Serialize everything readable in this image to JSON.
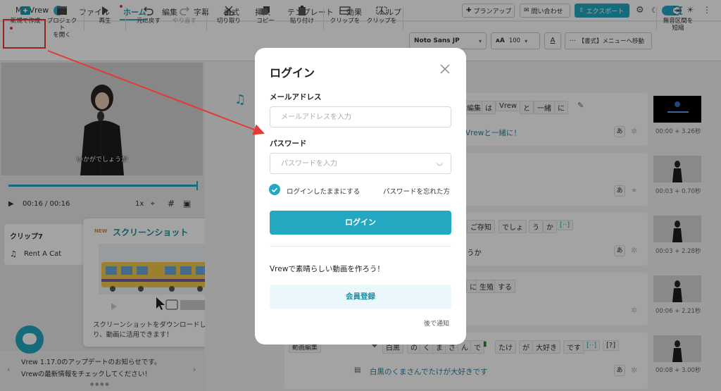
{
  "menubar": {
    "app_title": "My Vrew",
    "items": [
      "ファイル",
      "ホーム",
      "編集",
      "字幕",
      "書式",
      "挿入",
      "テンプレート",
      "効果",
      "ヘルプ"
    ],
    "plan_up": "プランアップ",
    "contact": "問い合わせ",
    "export": "エクスポート"
  },
  "toolbar": {
    "new_project": "新規で作成",
    "open_project_1": "プロジェクト",
    "open_project_2": "を開く",
    "play": "再生",
    "undo": "元に戻す",
    "redo": "やり直す",
    "cut": "切り取り",
    "copy": "コピー",
    "paste": "貼り付け",
    "clip1": "クリップを",
    "clip2": "クリップを",
    "font": "Noto Sans JP",
    "size": "100",
    "color_letter": "A",
    "format_menu": "【書式】メニューへ移動",
    "silence_1": "無音区間を",
    "silence_2": "短縮"
  },
  "player": {
    "subtitle": "いかがでしょうか",
    "current_time": "00:16",
    "total_time": "/ 00:16",
    "speed": "1x",
    "progress": 1.0
  },
  "clip_panel": {
    "clip_name": "クリップ7",
    "music_name": "Rent A Cat"
  },
  "screenshot_popup": {
    "badge": "NEW",
    "title": "スクリーンショット",
    "description": "スクリーンショットをダウンロードしたり、動画に活用できます！"
  },
  "update_bar": {
    "title": "Vrew 1.17.0のアップデートのお知らせです。",
    "subtitle": "Vrewの最新情報をチェックしてください！"
  },
  "rows": [
    {
      "words": [
        "編集",
        "は",
        "Vrew",
        "と",
        "一緒",
        "に"
      ],
      "caption": "Vrewと一緒に！",
      "time": "00:00 + 3.26秒"
    },
    {
      "words": [],
      "caption": "",
      "time": "00:03 + 0.70秒"
    },
    {
      "words": [
        "ご存知",
        "でしょ",
        "う",
        "か",
        "[··]"
      ],
      "caption": "うか",
      "time": "00:03 + 2.28秒"
    },
    {
      "words": [
        "に",
        "生殖",
        "する"
      ],
      "caption": "",
      "time": "00:06 + 2.21秒"
    },
    {
      "words": [
        "動画編集",
        "白黒",
        "の",
        "く",
        "ま",
        "さ",
        "ん",
        "で",
        "たけ",
        "が",
        "大好き",
        "です",
        "[··]",
        "[?]"
      ],
      "caption": "白黒のくまさんでたけが大好きです",
      "time": "00:08 + 3.00秒"
    }
  ],
  "small_glyph": "あ",
  "login": {
    "title": "ログイン",
    "email_label": "メールアドレス",
    "email_placeholder": "メールアドレスを入力",
    "password_label": "パスワード",
    "password_placeholder": "パスワードを入力",
    "remember": "ログインしたままにする",
    "forgot": "パスワードを忘れた方",
    "login_button": "ログイン",
    "promo": "Vrewで素晴らしい動画を作ろう！",
    "signup_button": "会員登録",
    "later": "後で通知"
  },
  "colors": {
    "accent": "#22a8c0",
    "annotation_red": "#e53935"
  }
}
